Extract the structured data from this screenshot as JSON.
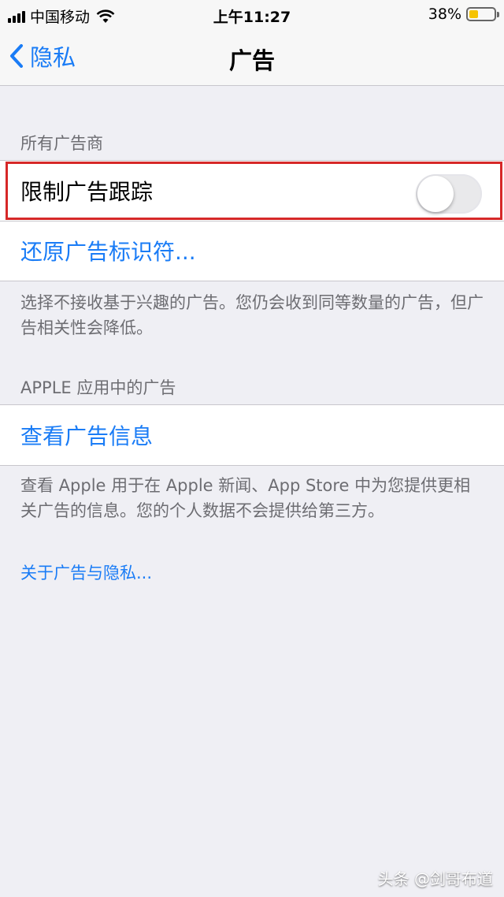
{
  "status_bar": {
    "carrier": "中国移动",
    "time": "上午11:27",
    "battery": "38%",
    "battery_level": 0.38,
    "icons": [
      "signal-icon",
      "wifi-icon",
      "battery-icon"
    ]
  },
  "nav": {
    "back_label": "隐私",
    "title": "广告"
  },
  "section_all": {
    "header": "所有广告商",
    "limit_tracking_label": "限制广告跟踪",
    "limit_tracking_on": false,
    "reset_label": "还原广告标识符...",
    "footer": "选择不接收基于兴趣的广告。您仍会收到同等数量的广告，但广告相关性会降低。"
  },
  "section_apple": {
    "header": "APPLE 应用中的广告",
    "view_info_label": "查看广告信息",
    "footer": "查看 Apple 用于在 Apple 新闻、App Store 中为您提供更相关广告的信息。您的个人数据不会提供给第三方。"
  },
  "about_link": "关于广告与隐私...",
  "watermark": "头条 @剑哥布道",
  "colors": {
    "accent": "#1a7cf6",
    "background": "#efeff4",
    "highlight": "#d62828"
  }
}
